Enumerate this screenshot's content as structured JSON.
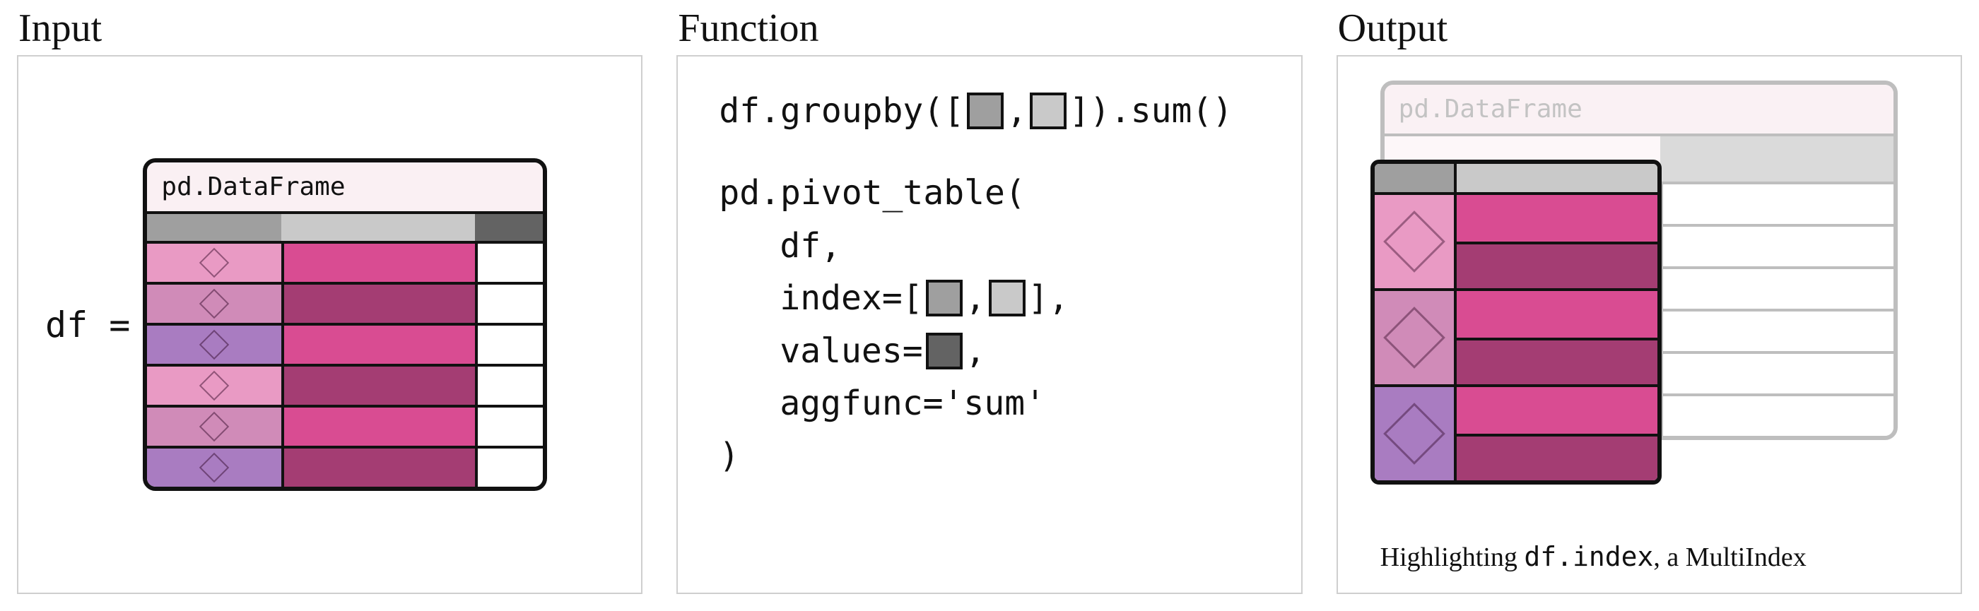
{
  "headings": {
    "input": "Input",
    "function": "Function",
    "output": "Output"
  },
  "input": {
    "assignment": "df =",
    "frame_label": "pd.DataFrame",
    "header_colors": [
      "mid-gray",
      "light-gray",
      "dark-gray"
    ],
    "rows": [
      {
        "idx_color": "p1",
        "val_color": "v1",
        "shape": "diamond"
      },
      {
        "idx_color": "p2",
        "val_color": "v2",
        "shape": "diamond"
      },
      {
        "idx_color": "p3",
        "val_color": "v1",
        "shape": "diamond"
      },
      {
        "idx_color": "p1",
        "val_color": "v2",
        "shape": "diamond"
      },
      {
        "idx_color": "p2",
        "val_color": "v1",
        "shape": "diamond"
      },
      {
        "idx_color": "p3",
        "val_color": "v2",
        "shape": "diamond"
      }
    ]
  },
  "function": {
    "groupby": {
      "pre": "df.groupby([",
      "sep": ",",
      "post": "]).sum()",
      "key_colors": [
        "mid",
        "light"
      ]
    },
    "pivot": {
      "open": "pd.pivot_table(",
      "arg_df": "df,",
      "index_pre": "index=[",
      "index_sep": ",",
      "index_post": "],",
      "index_key_colors": [
        "mid",
        "light"
      ],
      "values_pre": "values=",
      "values_key_color": "dark",
      "values_post": ",",
      "aggfunc": "aggfunc='sum'",
      "close": ")"
    }
  },
  "output": {
    "frame_label": "pd.DataFrame",
    "background_rows": 6,
    "groups": [
      {
        "idx_color": "p1",
        "vals": [
          "v1",
          "v2"
        ],
        "shape": "diamond"
      },
      {
        "idx_color": "p2",
        "vals": [
          "v1",
          "v2"
        ],
        "shape": "diamond"
      },
      {
        "idx_color": "p3",
        "vals": [
          "v1",
          "v2"
        ],
        "shape": "diamond"
      }
    ],
    "caption_pre": "Highlighting ",
    "caption_code": "df.index",
    "caption_post": ", a MultiIndex"
  }
}
